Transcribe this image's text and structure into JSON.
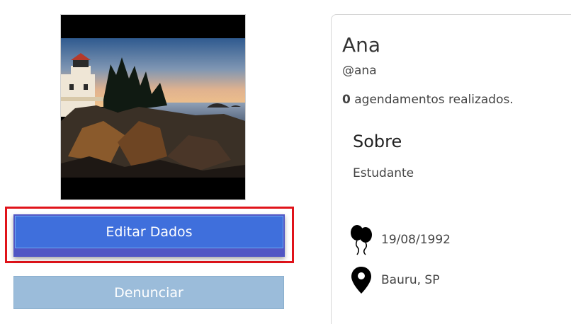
{
  "profile": {
    "name": "Ana",
    "handle": "@ana",
    "appointments_count": "0",
    "appointments_label": " agendamentos realizados."
  },
  "about": {
    "heading": "Sobre",
    "text": "Estudante"
  },
  "details": {
    "birthday": "19/08/1992",
    "birthday_icon": "balloons-icon",
    "location": "Bauru, SP",
    "location_icon": "map-pin-icon"
  },
  "actions": {
    "edit_label": "Editar Dados",
    "report_label": "Denunciar"
  },
  "colors": {
    "edit_button": "#3f6fdc",
    "report_button": "#9bbcda",
    "highlight": "#e0131a"
  }
}
